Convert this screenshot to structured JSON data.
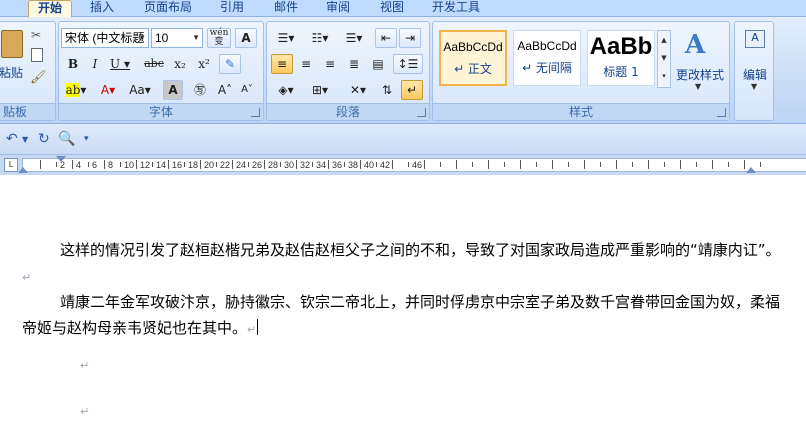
{
  "tabs": [
    {
      "label": "开始",
      "active": true
    },
    {
      "label": "插入"
    },
    {
      "label": "页面布局"
    },
    {
      "label": "引用"
    },
    {
      "label": "邮件"
    },
    {
      "label": "审阅"
    },
    {
      "label": "视图"
    },
    {
      "label": "开发工具"
    }
  ],
  "clipboard": {
    "paste_label": "粘贴",
    "group_label": "贴板"
  },
  "font": {
    "name": "宋体 (中文标题",
    "size": "10",
    "group_label": "字体"
  },
  "paragraph": {
    "group_label": "段落"
  },
  "styles": {
    "items": [
      {
        "sample": "AaBbCcDd",
        "name": "↵ 正文",
        "selected": true
      },
      {
        "sample": "AaBbCcDd",
        "name": "↵ 无间隔"
      },
      {
        "sample": "AaBb",
        "name": "标题 1"
      }
    ],
    "change_label": "更改样式",
    "group_label": "样式"
  },
  "editing": {
    "label": "编辑"
  },
  "ruler": {
    "numbers": [
      "2",
      "4",
      "6",
      "8",
      "10",
      "12",
      "14",
      "16",
      "18",
      "20",
      "22",
      "24",
      "26",
      "28",
      "30",
      "32",
      "34",
      "36",
      "38",
      "40",
      "42",
      "46"
    ]
  },
  "document": {
    "paragraphs": [
      "这样的情况引发了赵桓赵楷兄弟及赵佶赵桓父子之间的不和，导致了对国家政局造成严重影响的“靖康内讧”。",
      "靖康二年金军攻破汴京，胁持徽宗、钦宗二帝北上，并同时俘虏京中宗室子弟及数千宫眷带回金国为奴，柔福帝姬与赵构母亲韦贤妃也在其中。"
    ],
    "para_mark": "↵"
  },
  "colors": {
    "accent": "#15428b",
    "ribbon": "#c9ddf6",
    "selected_style": "#f2b24a"
  }
}
